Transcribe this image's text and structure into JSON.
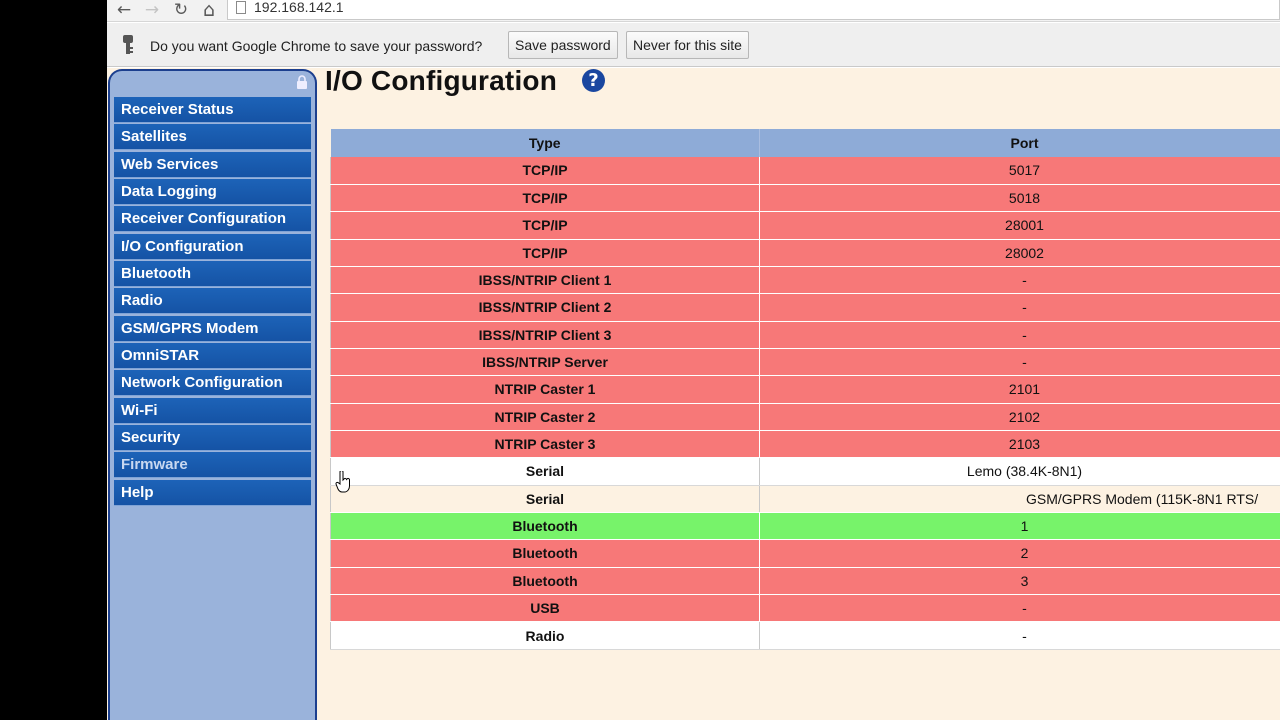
{
  "browser": {
    "url": "192.168.142.1",
    "back_icon": "←",
    "forward_icon": "→",
    "reload_icon": "↻",
    "home_icon": "⌂"
  },
  "infobar": {
    "message": "Do you want Google Chrome to save your password?",
    "save_label": "Save password",
    "never_label": "Never for this site"
  },
  "page": {
    "title": "I/O Configuration",
    "help_glyph": "?"
  },
  "sidebar": {
    "items": [
      {
        "label": "Receiver Status"
      },
      {
        "label": "Satellites"
      },
      {
        "label": "Web Services"
      },
      {
        "label": "Data Logging"
      },
      {
        "label": "Receiver Configuration"
      },
      {
        "label": "I/O Configuration"
      },
      {
        "label": "Bluetooth"
      },
      {
        "label": "Radio"
      },
      {
        "label": "GSM/GPRS Modem"
      },
      {
        "label": "OmniSTAR"
      },
      {
        "label": "Network Configuration"
      },
      {
        "label": "Wi-Fi"
      },
      {
        "label": "Security"
      },
      {
        "label": "Firmware"
      },
      {
        "label": "Help"
      }
    ]
  },
  "table": {
    "headers": {
      "type": "Type",
      "port": "Port"
    },
    "rows": [
      {
        "type": "TCP/IP",
        "port": "5017",
        "status": "red"
      },
      {
        "type": "TCP/IP",
        "port": "5018",
        "status": "red"
      },
      {
        "type": "TCP/IP",
        "port": "28001",
        "status": "red"
      },
      {
        "type": "TCP/IP",
        "port": "28002",
        "status": "red"
      },
      {
        "type": "IBSS/NTRIP Client 1",
        "port": "-",
        "status": "red"
      },
      {
        "type": "IBSS/NTRIP Client 2",
        "port": "-",
        "status": "red"
      },
      {
        "type": "IBSS/NTRIP Client 3",
        "port": "-",
        "status": "red"
      },
      {
        "type": "IBSS/NTRIP Server",
        "port": "-",
        "status": "red"
      },
      {
        "type": "NTRIP Caster 1",
        "port": "2101",
        "status": "red"
      },
      {
        "type": "NTRIP Caster 2",
        "port": "2102",
        "status": "red"
      },
      {
        "type": "NTRIP Caster 3",
        "port": "2103",
        "status": "red"
      },
      {
        "type": "Serial",
        "port": "Lemo (38.4K-8N1)",
        "status": "white"
      },
      {
        "type": "Serial",
        "port": "GSM/GPRS Modem (115K-8N1 RTS/",
        "status": "cream"
      },
      {
        "type": "Bluetooth",
        "port": "1",
        "status": "green"
      },
      {
        "type": "Bluetooth",
        "port": "2",
        "status": "red"
      },
      {
        "type": "Bluetooth",
        "port": "3",
        "status": "red"
      },
      {
        "type": "USB",
        "port": "-",
        "status": "red"
      },
      {
        "type": "Radio",
        "port": "-",
        "status": "white"
      }
    ]
  },
  "colors": {
    "red": "#f77878",
    "green": "#77f36a",
    "header": "#8eabd7",
    "menu": "#1a5cb0",
    "background": "#fdf2e2"
  }
}
